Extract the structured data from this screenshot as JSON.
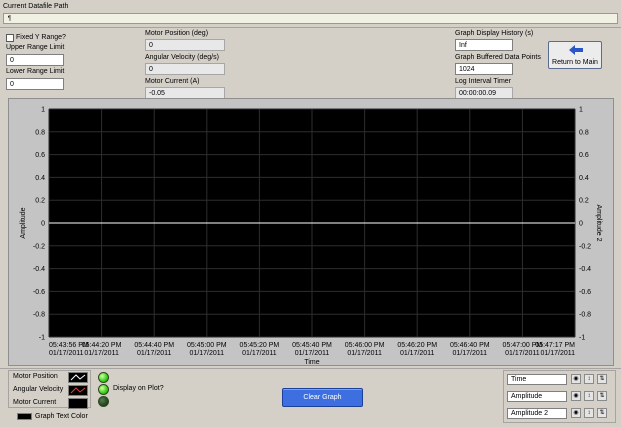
{
  "header": {
    "datafile_label": "Current Datafile Path",
    "path_icon": "path-icon"
  },
  "left_controls": {
    "fixed_y_label": "Fixed Y Range?",
    "fixed_y_checked": false,
    "upper_label": "Upper Range Limit",
    "upper_value": "0",
    "lower_label": "Lower Range Limit",
    "lower_value": "0"
  },
  "middle_indicators": {
    "motor_position_label": "Motor Position (deg)",
    "motor_position_value": "0",
    "angular_velocity_label": "Angular Velocity (deg/s)",
    "angular_velocity_value": "0",
    "motor_current_label": "Motor Current (A)",
    "motor_current_value": "-0.05"
  },
  "right_indicators": {
    "history_label": "Graph Display History (s)",
    "history_value": "Inf",
    "buffered_label": "Graph Buffered Data Points",
    "buffered_value": "1024",
    "log_timer_label": "Log Interval Timer",
    "log_timer_value": "00:00:00.09",
    "return_button_label": "Return to Main",
    "return_icon": "arrow-left-icon"
  },
  "chart_data": {
    "type": "line",
    "ylabel": "Amplitude",
    "y2label": "Amplitude 2",
    "xlabel": "Time",
    "ylim": [
      -1,
      1
    ],
    "y_ticks": [
      "1",
      "0.8",
      "0.6",
      "0.4",
      "0.2",
      "0",
      "-0.2",
      "-0.4",
      "-0.6",
      "-0.8",
      "-1"
    ],
    "x_ticks": [
      {
        "time": "05:43:56 PM",
        "date": "01/17/2011"
      },
      {
        "time": "05:44:20 PM",
        "date": "01/17/2011"
      },
      {
        "time": "05:44:40 PM",
        "date": "01/17/2011"
      },
      {
        "time": "05:45:00 PM",
        "date": "01/17/2011"
      },
      {
        "time": "05:45:20 PM",
        "date": "01/17/2011"
      },
      {
        "time": "05:45:40 PM",
        "date": "01/17/2011"
      },
      {
        "time": "05:46:00 PM",
        "date": "01/17/2011"
      },
      {
        "time": "05:46:20 PM",
        "date": "01/17/2011"
      },
      {
        "time": "05:46:40 PM",
        "date": "01/17/2011"
      },
      {
        "time": "05:47:00 PM",
        "date": "01/17/2011"
      },
      {
        "time": "05:47:17 PM",
        "date": "01/17/2011"
      }
    ],
    "series": [
      {
        "name": "Motor Position",
        "y": 0,
        "color": "#ffffff"
      }
    ],
    "plot_background": "#000000",
    "grid": true
  },
  "legend": {
    "items": [
      "Motor Position",
      "Angular Velocity",
      "Motor Current"
    ],
    "display_label": "Display on Plot?",
    "leds": [
      true,
      true,
      false
    ],
    "text_color_label": "Graph Text Color"
  },
  "clear_button_label": "Clear Graph",
  "scale_legend": {
    "items": [
      "Time",
      "Amplitude",
      "Amplitude 2"
    ]
  },
  "colors": {
    "panel": "#d4d0c8",
    "plot_bg": "#000000",
    "button_blue": "#3d6fe0"
  }
}
